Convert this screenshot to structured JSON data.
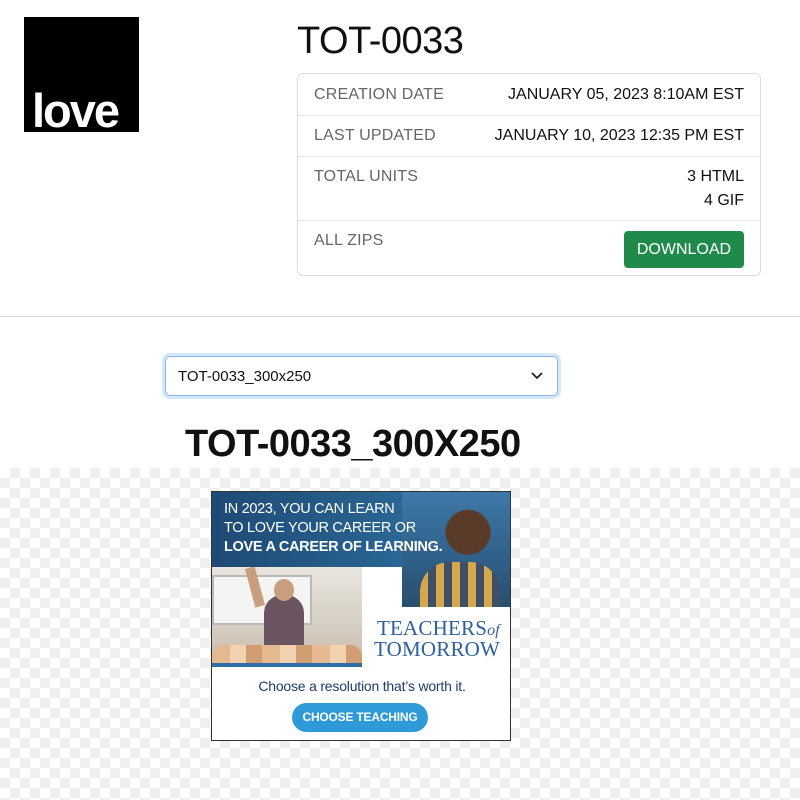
{
  "brand": {
    "logo_text": "love"
  },
  "project": {
    "title": "TOT-0033"
  },
  "info": {
    "creation_date_label": "CREATION DATE",
    "creation_date_value": "JANUARY 05, 2023 8:10AM EST",
    "last_updated_label": "LAST UPDATED",
    "last_updated_value": "JANUARY 10, 2023 12:35 PM EST",
    "total_units_label": "TOTAL UNITS",
    "total_units_html": "3 HTML",
    "total_units_gif": "4 GIF",
    "all_zips_label": "ALL ZIPS",
    "download_label": "DOWNLOAD"
  },
  "unit_select": {
    "selected": "TOT-0033_300x250"
  },
  "unit": {
    "title": "TOT-0033_300X250"
  },
  "ad": {
    "headline_1": "IN 2023, YOU CAN LEARN",
    "headline_2": "TO LOVE YOUR CAREER OR",
    "headline_3": "LOVE A CAREER OF LEARNING.",
    "logo_teachers": "TEACHERS",
    "logo_of": "of",
    "logo_tomorrow": "TOMORROW",
    "tagline": "Choose a resolution that’s worth it.",
    "cta": "CHOOSE TEACHING"
  },
  "colors": {
    "download_button": "#1f8a4c",
    "cta_button": "#2f9ad8",
    "ad_blue": "#2f5f9e"
  }
}
